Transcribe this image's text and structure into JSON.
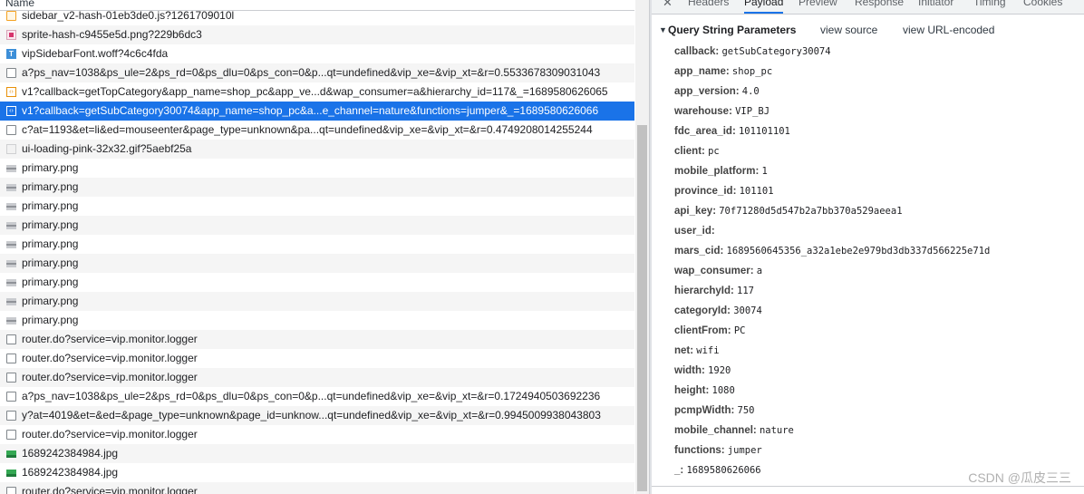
{
  "request_list": {
    "header": "Name",
    "rows": [
      {
        "icon": "js",
        "name": "sidebar_v2-hash-01eb3de0.js?1261709010l"
      },
      {
        "icon": "img-pink",
        "name": "sprite-hash-c9455e5d.png?229b6dc3"
      },
      {
        "icon": "font",
        "name": "vipSidebarFont.woff?4c6c4fda"
      },
      {
        "icon": "doc",
        "name": "a?ps_nav=1038&ps_ule=2&ps_rd=0&ps_dlu=0&ps_con=0&p...qt=undefined&vip_xe=&vip_xt=&r=0.5533678309031043"
      },
      {
        "icon": "xhr",
        "name": "v1?callback=getTopCategory&app_name=shop_pc&app_ve...d&wap_consumer=a&hierarchy_id=117&_=1689580626065"
      },
      {
        "icon": "xhr",
        "name": "v1?callback=getSubCategory30074&app_name=shop_pc&a...e_channel=nature&functions=jumper&_=1689580626066",
        "selected": true
      },
      {
        "icon": "doc",
        "name": "c?at=1193&et=li&ed=mouseenter&page_type=unknown&pa...qt=undefined&vip_xe=&vip_xt=&r=0.4749208014255244"
      },
      {
        "icon": "gif",
        "name": "ui-loading-pink-32x32.gif?5aebf25a"
      },
      {
        "icon": "png",
        "name": "primary.png"
      },
      {
        "icon": "png",
        "name": "primary.png"
      },
      {
        "icon": "png",
        "name": "primary.png"
      },
      {
        "icon": "png",
        "name": "primary.png"
      },
      {
        "icon": "png",
        "name": "primary.png"
      },
      {
        "icon": "png",
        "name": "primary.png"
      },
      {
        "icon": "png",
        "name": "primary.png"
      },
      {
        "icon": "png",
        "name": "primary.png"
      },
      {
        "icon": "png",
        "name": "primary.png"
      },
      {
        "icon": "doc",
        "name": "router.do?service=vip.monitor.logger"
      },
      {
        "icon": "doc",
        "name": "router.do?service=vip.monitor.logger"
      },
      {
        "icon": "doc",
        "name": "router.do?service=vip.monitor.logger"
      },
      {
        "icon": "doc",
        "name": "a?ps_nav=1038&ps_ule=2&ps_rd=0&ps_dlu=0&ps_con=0&p...qt=undefined&vip_xe=&vip_xt=&r=0.1724940503692236"
      },
      {
        "icon": "doc",
        "name": "y?at=4019&et=&ed=&page_type=unknown&page_id=unknow...qt=undefined&vip_xe=&vip_xt=&r=0.9945009938043803"
      },
      {
        "icon": "doc",
        "name": "router.do?service=vip.monitor.logger"
      },
      {
        "icon": "jpg",
        "name": "1689242384984.jpg"
      },
      {
        "icon": "jpg",
        "name": "1689242384984.jpg"
      },
      {
        "icon": "doc",
        "name": "router.do?service=vip.monitor.logger"
      }
    ]
  },
  "tabs": {
    "close": "✕",
    "items": [
      "Headers",
      "Payload",
      "Preview",
      "Response",
      "Initiator",
      "Timing",
      "Cookies"
    ],
    "active": "Payload"
  },
  "payload": {
    "section_arrow": "▼",
    "section_title": "Query String Parameters",
    "view_source": "view source",
    "view_encoded": "view URL-encoded",
    "params": [
      {
        "key": "callback",
        "value": "getSubCategory30074"
      },
      {
        "key": "app_name",
        "value": "shop_pc"
      },
      {
        "key": "app_version",
        "value": "4.0"
      },
      {
        "key": "warehouse",
        "value": "VIP_BJ"
      },
      {
        "key": "fdc_area_id",
        "value": "101101101"
      },
      {
        "key": "client",
        "value": "pc"
      },
      {
        "key": "mobile_platform",
        "value": "1"
      },
      {
        "key": "province_id",
        "value": "101101"
      },
      {
        "key": "api_key",
        "value": "70f71280d5d547b2a7bb370a529aeea1"
      },
      {
        "key": "user_id",
        "value": ""
      },
      {
        "key": "mars_cid",
        "value": "1689560645356_a32a1ebe2e979bd3db337d566225e71d"
      },
      {
        "key": "wap_consumer",
        "value": "a"
      },
      {
        "key": "hierarchyId",
        "value": "117"
      },
      {
        "key": "categoryId",
        "value": "30074"
      },
      {
        "key": "clientFrom",
        "value": "PC"
      },
      {
        "key": "net",
        "value": "wifi"
      },
      {
        "key": "width",
        "value": "1920"
      },
      {
        "key": "height",
        "value": "1080"
      },
      {
        "key": "pcmpWidth",
        "value": "750"
      },
      {
        "key": "mobile_channel",
        "value": "nature"
      },
      {
        "key": "functions",
        "value": "jumper"
      },
      {
        "key": "_",
        "value": "1689580626066"
      }
    ]
  },
  "watermark": "CSDN @瓜皮三三",
  "colors": {
    "selected": "#1a73e8",
    "tab_underline": "#1a73e8"
  }
}
